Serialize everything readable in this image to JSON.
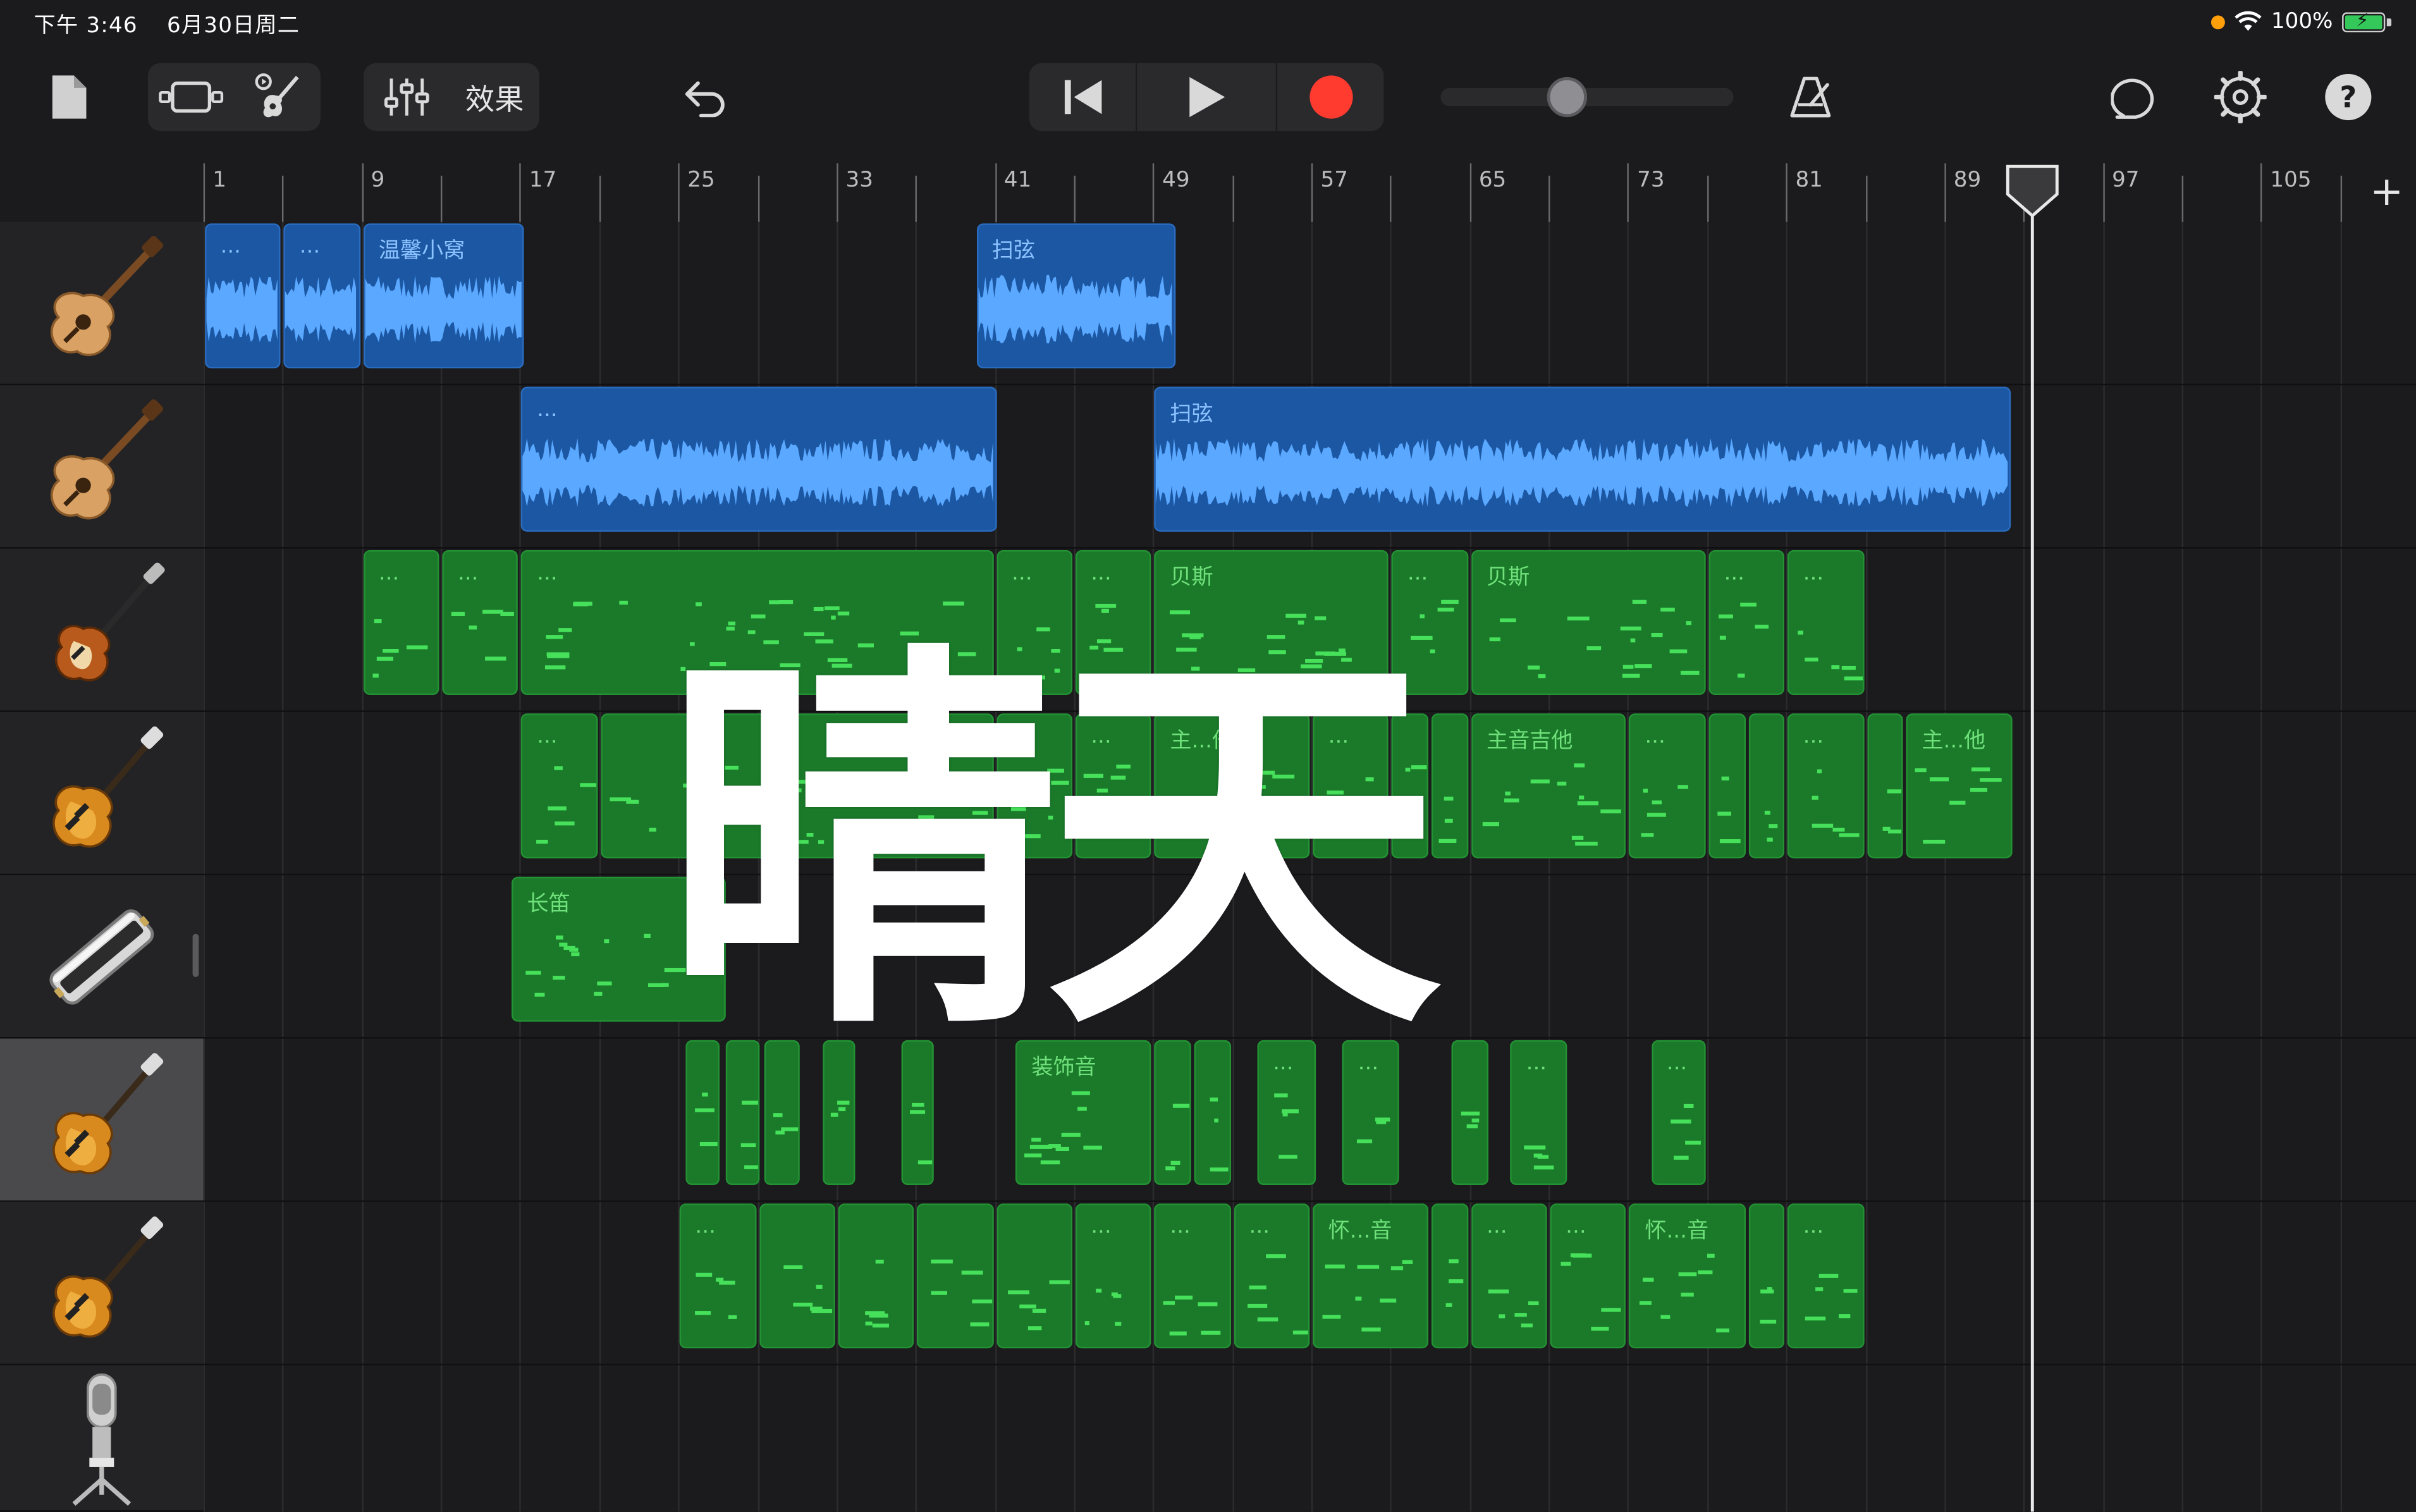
{
  "status_bar": {
    "time": "下午 3:46",
    "date": "6月30日周二",
    "battery": "100%"
  },
  "toolbar": {
    "effects_label": "效果",
    "icons": [
      "document-icon",
      "view-toggle-icon",
      "instrument-icon",
      "mixer-icon",
      "undo-icon",
      "go-to-start-icon",
      "play-icon",
      "record-icon",
      "metronome-icon",
      "loop-icon",
      "settings-icon",
      "help-icon"
    ],
    "record_color": "#ff3b30"
  },
  "ruler": {
    "bars": [
      "1",
      "9",
      "17",
      "25",
      "33",
      "41",
      "49",
      "57",
      "65",
      "73",
      "81",
      "89",
      "97",
      "105"
    ],
    "add_label": "+"
  },
  "overlay_title": "晴天",
  "tracks": [
    {
      "name": "acoustic-guitar-1",
      "icon": "acoustic-guitar-icon"
    },
    {
      "name": "acoustic-guitar-2",
      "icon": "acoustic-guitar-icon"
    },
    {
      "name": "bass",
      "icon": "bass-guitar-icon"
    },
    {
      "name": "electric-guitar-1",
      "icon": "electric-guitar-icon"
    },
    {
      "name": "harmonica",
      "icon": "harmonica-icon"
    },
    {
      "name": "electric-guitar-2",
      "icon": "electric-guitar-icon",
      "selected": true
    },
    {
      "name": "electric-guitar-3",
      "icon": "electric-guitar-icon"
    },
    {
      "name": "vocal-mic",
      "icon": "microphone-icon"
    }
  ],
  "regions": [
    {
      "track": 0,
      "type": "audio",
      "start": 1,
      "end": 5,
      "label": "..."
    },
    {
      "track": 0,
      "type": "audio",
      "start": 5,
      "end": 9,
      "label": "..."
    },
    {
      "track": 0,
      "type": "audio",
      "start": 9,
      "end": 17.3,
      "label": "温馨小窝"
    },
    {
      "track": 0,
      "type": "audio",
      "start": 40,
      "end": 50.2,
      "label": "扫弦"
    },
    {
      "track": 1,
      "type": "audio",
      "start": 17,
      "end": 41.2,
      "label": "..."
    },
    {
      "track": 1,
      "type": "audio",
      "start": 49,
      "end": 92.4,
      "label": "扫弦"
    },
    {
      "track": 2,
      "type": "midi",
      "start": 9,
      "end": 13,
      "label": "..."
    },
    {
      "track": 2,
      "type": "midi",
      "start": 13,
      "end": 17,
      "label": "..."
    },
    {
      "track": 2,
      "type": "midi",
      "start": 17,
      "end": 41,
      "label": "..."
    },
    {
      "track": 2,
      "type": "midi",
      "start": 41,
      "end": 45,
      "label": "..."
    },
    {
      "track": 2,
      "type": "midi",
      "start": 45,
      "end": 49,
      "label": "..."
    },
    {
      "track": 2,
      "type": "midi",
      "start": 49,
      "end": 61,
      "label": "贝斯"
    },
    {
      "track": 2,
      "type": "midi",
      "start": 61,
      "end": 65,
      "label": "..."
    },
    {
      "track": 2,
      "type": "midi",
      "start": 65,
      "end": 77,
      "label": "贝斯"
    },
    {
      "track": 2,
      "type": "midi",
      "start": 77,
      "end": 81,
      "label": "..."
    },
    {
      "track": 2,
      "type": "midi",
      "start": 81,
      "end": 85,
      "label": "..."
    },
    {
      "track": 3,
      "type": "midi",
      "start": 17,
      "end": 21,
      "label": "..."
    },
    {
      "track": 3,
      "type": "midi",
      "start": 21,
      "end": 41,
      "label": ""
    },
    {
      "track": 3,
      "type": "midi",
      "start": 41,
      "end": 45,
      "label": "..."
    },
    {
      "track": 3,
      "type": "midi",
      "start": 45,
      "end": 49,
      "label": "..."
    },
    {
      "track": 3,
      "type": "midi",
      "start": 49,
      "end": 57,
      "label": "主...他"
    },
    {
      "track": 3,
      "type": "midi",
      "start": 57,
      "end": 61,
      "label": "..."
    },
    {
      "track": 3,
      "type": "midi",
      "start": 61,
      "end": 63,
      "label": ""
    },
    {
      "track": 3,
      "type": "midi",
      "start": 63,
      "end": 65,
      "label": ""
    },
    {
      "track": 3,
      "type": "midi",
      "start": 65,
      "end": 73,
      "label": "主音吉他"
    },
    {
      "track": 3,
      "type": "midi",
      "start": 73,
      "end": 77,
      "label": "..."
    },
    {
      "track": 3,
      "type": "midi",
      "start": 77,
      "end": 79,
      "label": ""
    },
    {
      "track": 3,
      "type": "midi",
      "start": 79,
      "end": 81,
      "label": ""
    },
    {
      "track": 3,
      "type": "midi",
      "start": 81,
      "end": 85,
      "label": "..."
    },
    {
      "track": 3,
      "type": "midi",
      "start": 85,
      "end": 87,
      "label": ""
    },
    {
      "track": 3,
      "type": "midi",
      "start": 87,
      "end": 92.5,
      "label": "主...他"
    },
    {
      "track": 4,
      "type": "midi",
      "start": 16.5,
      "end": 27.5,
      "label": "长笛"
    },
    {
      "track": 5,
      "type": "midi",
      "start": 25.3,
      "end": 27.2,
      "label": ""
    },
    {
      "track": 5,
      "type": "midi",
      "start": 27.3,
      "end": 29.2,
      "label": ""
    },
    {
      "track": 5,
      "type": "midi",
      "start": 29.3,
      "end": 31.2,
      "label": ""
    },
    {
      "track": 5,
      "type": "midi",
      "start": 32.2,
      "end": 34,
      "label": ""
    },
    {
      "track": 5,
      "type": "midi",
      "start": 36.2,
      "end": 38,
      "label": ""
    },
    {
      "track": 5,
      "type": "midi",
      "start": 42,
      "end": 49,
      "label": "装饰音"
    },
    {
      "track": 5,
      "type": "midi",
      "start": 49,
      "end": 51,
      "label": ""
    },
    {
      "track": 5,
      "type": "midi",
      "start": 51,
      "end": 53,
      "label": ""
    },
    {
      "track": 5,
      "type": "midi",
      "start": 54.2,
      "end": 57.3,
      "label": "..."
    },
    {
      "track": 5,
      "type": "midi",
      "start": 58.5,
      "end": 61.5,
      "label": "..."
    },
    {
      "track": 5,
      "type": "midi",
      "start": 64,
      "end": 66,
      "label": ""
    },
    {
      "track": 5,
      "type": "midi",
      "start": 67,
      "end": 70,
      "label": "..."
    },
    {
      "track": 5,
      "type": "midi",
      "start": 74.1,
      "end": 77,
      "label": "..."
    },
    {
      "track": 6,
      "type": "midi",
      "start": 25,
      "end": 29,
      "label": "..."
    },
    {
      "track": 6,
      "type": "midi",
      "start": 29,
      "end": 33,
      "label": ""
    },
    {
      "track": 6,
      "type": "midi",
      "start": 33,
      "end": 37,
      "label": ""
    },
    {
      "track": 6,
      "type": "midi",
      "start": 37,
      "end": 41,
      "label": ""
    },
    {
      "track": 6,
      "type": "midi",
      "start": 41,
      "end": 45,
      "label": ""
    },
    {
      "track": 6,
      "type": "midi",
      "start": 45,
      "end": 49,
      "label": "..."
    },
    {
      "track": 6,
      "type": "midi",
      "start": 49,
      "end": 53,
      "label": "..."
    },
    {
      "track": 6,
      "type": "midi",
      "start": 53,
      "end": 57,
      "label": "..."
    },
    {
      "track": 6,
      "type": "midi",
      "start": 57,
      "end": 63,
      "label": "怀...音"
    },
    {
      "track": 6,
      "type": "midi",
      "start": 63,
      "end": 65,
      "label": ""
    },
    {
      "track": 6,
      "type": "midi",
      "start": 65,
      "end": 69,
      "label": "..."
    },
    {
      "track": 6,
      "type": "midi",
      "start": 69,
      "end": 73,
      "label": "..."
    },
    {
      "track": 6,
      "type": "midi",
      "start": 73,
      "end": 79,
      "label": "怀...音"
    },
    {
      "track": 6,
      "type": "midi",
      "start": 79,
      "end": 81,
      "label": ""
    },
    {
      "track": 6,
      "type": "midi",
      "start": 81,
      "end": 85,
      "label": "..."
    }
  ],
  "playhead_bar": 92.5,
  "colors": {
    "audio_region": "#1b57a3",
    "midi_region": "#1a7a2a",
    "audio_wave": "#5aa8ff",
    "midi_note": "#46e05a",
    "accent": "#ff3b30"
  }
}
